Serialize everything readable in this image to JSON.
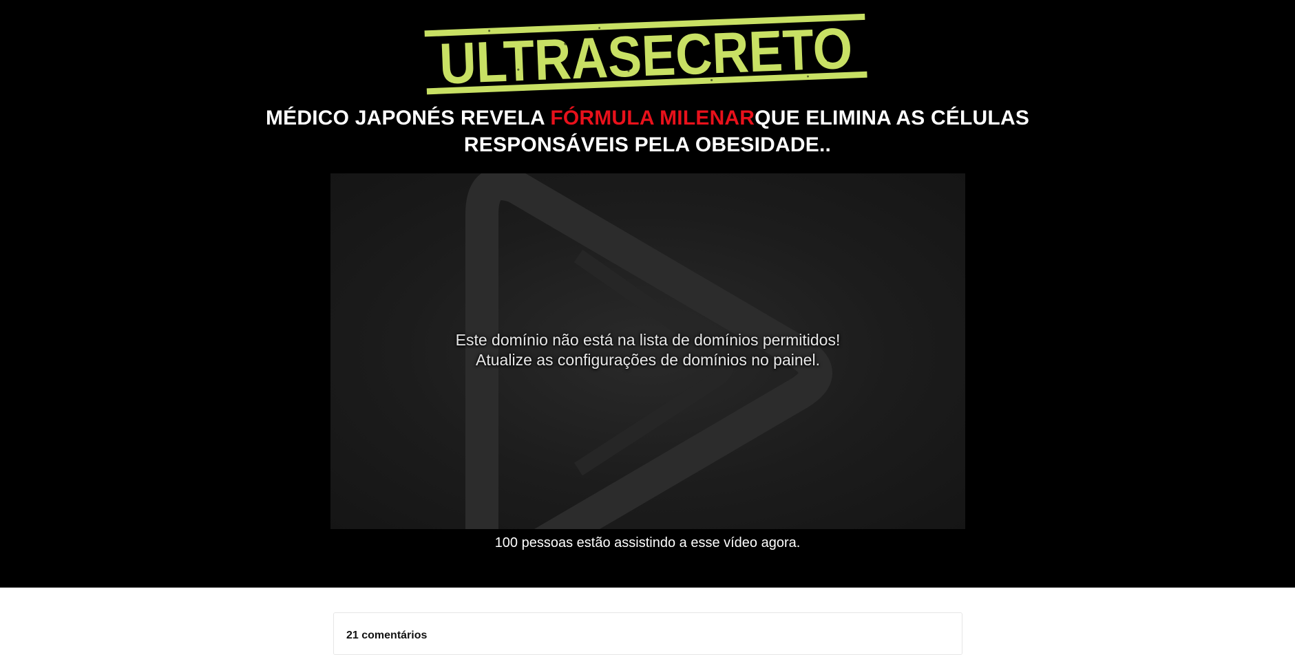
{
  "brand": {
    "logo_text": "ULTRASECRETO",
    "logo_color": "#c8e064"
  },
  "headline": {
    "part1": "MÉDICO JAPONÉS REVELA ",
    "highlight": "FÓRMULA MILENAR",
    "part2": "QUE ELIMINA AS CÉLULAS",
    "line2": "RESPONSÁVEIS PELA OBESIDADE..",
    "highlight_color": "#e8111b"
  },
  "video": {
    "icon": "play-icon",
    "message_line1": "Este domínio não está na lista de domínios permitidos!",
    "message_line2": "Atualize as configurações de domínios no painel."
  },
  "viewers_text": "100 pessoas estão assistindo a esse vídeo agora.",
  "comments": {
    "count_text": "21 comentários"
  }
}
